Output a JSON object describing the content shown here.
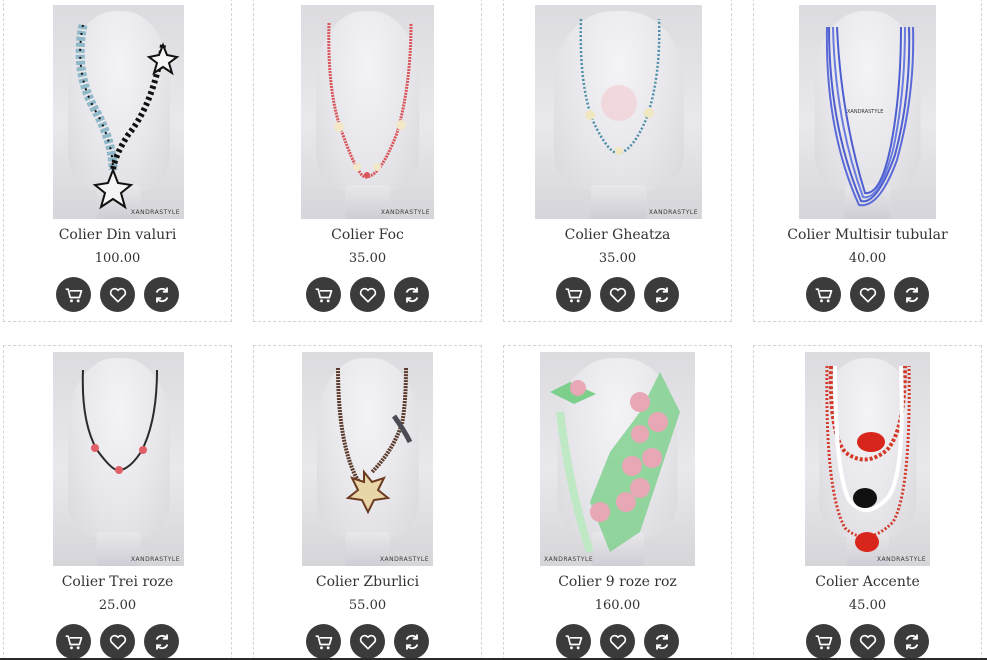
{
  "products": [
    {
      "name": "Colier Din valuri",
      "price": "100.00",
      "watermark": "XANDRASTYLE",
      "colors": {
        "bead": "#8fb8c8",
        "accent": "#111111"
      }
    },
    {
      "name": "Colier Foc",
      "price": "35.00",
      "watermark": "XANDRASTYLE",
      "colors": {
        "bead": "#d9555a",
        "accent": "#f2e7c6"
      }
    },
    {
      "name": "Colier Gheatza",
      "price": "35.00",
      "watermark": "XANDRASTYLE",
      "colors": {
        "bead": "#4e8fa8",
        "accent": "#f0e6c0"
      }
    },
    {
      "name": "Colier Multisir tubular",
      "price": "40.00",
      "watermark": "XANDRASTYLE",
      "colors": {
        "bead": "#4d5ed0",
        "accent": "#6a7be0"
      }
    },
    {
      "name": "Colier Trei roze",
      "price": "25.00",
      "watermark": "XANDRASTYLE",
      "colors": {
        "bead": "#2a2a2a",
        "accent": "#e0606a"
      }
    },
    {
      "name": "Colier Zburlici",
      "price": "55.00",
      "watermark": "XANDRASTYLE",
      "colors": {
        "bead": "#5a3a2a",
        "accent": "#e8d6a8"
      }
    },
    {
      "name": "Colier 9 roze roz",
      "price": "160.00",
      "watermark": "XANDRASTYLE",
      "colors": {
        "bead": "#7ccf8a",
        "accent": "#e7a7b5"
      }
    },
    {
      "name": "Colier Accente",
      "price": "45.00",
      "watermark": "XANDRASTYLE",
      "colors": {
        "bead": "#d23a2a",
        "accent": "#111111"
      }
    }
  ],
  "actions": {
    "cart_icon": "cart-icon",
    "wishlist_icon": "heart-icon",
    "compare_icon": "refresh-icon"
  }
}
